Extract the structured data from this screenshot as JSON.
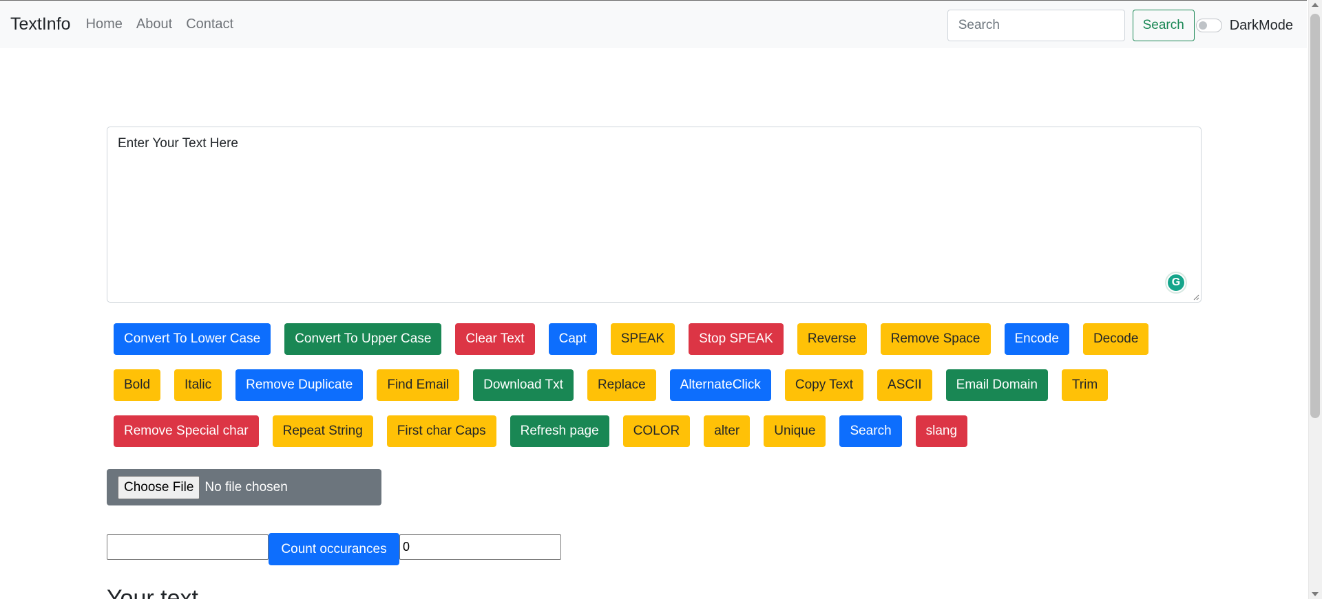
{
  "navbar": {
    "brand": "TextInfo",
    "links": [
      "Home",
      "About",
      "Contact"
    ],
    "search_placeholder": "Search",
    "search_button": "Search",
    "darkmode_label": "DarkMode"
  },
  "editor": {
    "placeholder": "Enter Your Text Here",
    "grammarly_icon": "G"
  },
  "button_rows": [
    [
      {
        "label": "Convert To Lower Case",
        "style": "primary"
      },
      {
        "label": "Convert To Upper Case",
        "style": "success"
      },
      {
        "label": "Clear Text",
        "style": "danger"
      },
      {
        "label": "Capt",
        "style": "primary"
      },
      {
        "label": "SPEAK",
        "style": "warning"
      },
      {
        "label": "Stop SPEAK",
        "style": "danger"
      },
      {
        "label": "Reverse",
        "style": "warning"
      },
      {
        "label": "Remove Space",
        "style": "warning"
      },
      {
        "label": "Encode",
        "style": "primary"
      },
      {
        "label": "Decode",
        "style": "warning"
      }
    ],
    [
      {
        "label": "Bold",
        "style": "warning"
      },
      {
        "label": "Italic",
        "style": "warning"
      },
      {
        "label": "Remove Duplicate",
        "style": "primary"
      },
      {
        "label": "Find Email",
        "style": "warning"
      },
      {
        "label": "Download Txt",
        "style": "success"
      },
      {
        "label": "Replace",
        "style": "warning"
      },
      {
        "label": "AlternateClick",
        "style": "primary"
      },
      {
        "label": "Copy Text",
        "style": "warning"
      },
      {
        "label": "ASCII",
        "style": "warning"
      },
      {
        "label": "Email Domain",
        "style": "success"
      },
      {
        "label": "Trim",
        "style": "warning"
      }
    ],
    [
      {
        "label": "Remove Special char",
        "style": "danger"
      },
      {
        "label": "Repeat String",
        "style": "warning"
      },
      {
        "label": "First char Caps",
        "style": "warning"
      },
      {
        "label": "Refresh page",
        "style": "success"
      },
      {
        "label": "COLOR",
        "style": "warning"
      },
      {
        "label": "alter",
        "style": "warning"
      },
      {
        "label": "Unique",
        "style": "warning"
      },
      {
        "label": "Search",
        "style": "primary"
      },
      {
        "label": "slang",
        "style": "danger"
      }
    ]
  ],
  "file_input": {
    "button_label": "Choose File",
    "status": "No file chosen"
  },
  "count": {
    "input_value": "",
    "button_label": "Count occurances",
    "result_value": "0"
  },
  "section_title": "Your text"
}
